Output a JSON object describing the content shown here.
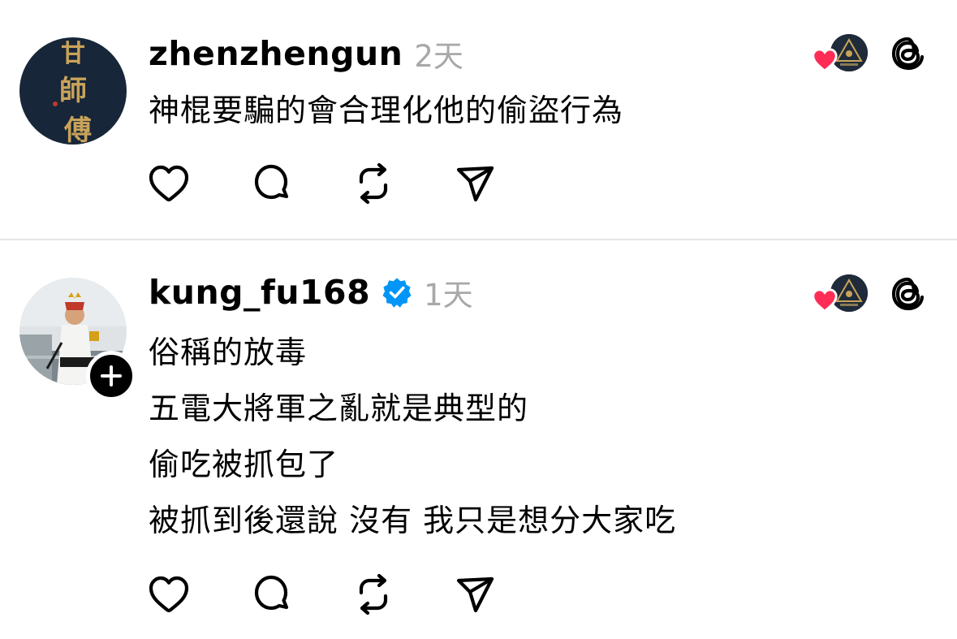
{
  "posts": [
    {
      "username": "zhenzhengun",
      "timestamp": "2天",
      "verified": false,
      "avatar_text": "甘師傅",
      "lines": [
        "神棍要騙的會合理化他的偷盜行為"
      ]
    },
    {
      "username": "kung_fu168",
      "timestamp": "1天",
      "verified": true,
      "lines": [
        "俗稱的放毒",
        "五電大將軍之亂就是典型的",
        "偷吃被抓包了",
        "被抓到後還說 沒有 我只是想分大家吃"
      ]
    }
  ],
  "icons": {
    "like": "heart-outline-icon",
    "reply": "speech-bubble-icon",
    "repost": "repost-icon",
    "share": "send-icon",
    "liked_by": "heart-filled-icon",
    "app": "threads-logo-icon",
    "verified": "verified-check-icon",
    "follow": "plus-icon"
  },
  "colors": {
    "text": "#000000",
    "muted": "#a8a8a8",
    "heart": "#ff2d55",
    "verified": "#0095f6",
    "divider": "#e6e6e6"
  }
}
